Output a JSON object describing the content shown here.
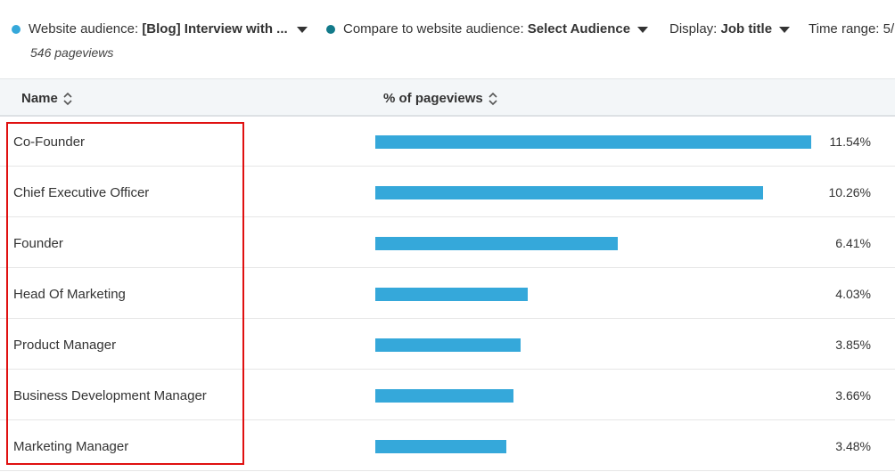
{
  "filters": {
    "audience_label": "Website audience:",
    "audience_value": "[Blog] Interview with ...",
    "audience_color": "#35a8da",
    "compare_label": "Compare to website audience:",
    "compare_value": "Select Audience",
    "compare_color": "#127a8a",
    "display_label": "Display:",
    "display_value": "Job title",
    "time_label": "Time range:",
    "time_value": "5/",
    "pageviews": "546 pageviews"
  },
  "table": {
    "columns": [
      "Name",
      "% of pageviews"
    ],
    "rows": [
      {
        "name": "Co-Founder",
        "percent": "11.54%",
        "value": 11.54
      },
      {
        "name": "Chief Executive Officer",
        "percent": "10.26%",
        "value": 10.26
      },
      {
        "name": "Founder",
        "percent": "6.41%",
        "value": 6.41
      },
      {
        "name": "Head Of Marketing",
        "percent": "4.03%",
        "value": 4.03
      },
      {
        "name": "Product Manager",
        "percent": "3.85%",
        "value": 3.85
      },
      {
        "name": "Business Development Manager",
        "percent": "3.66%",
        "value": 3.66
      },
      {
        "name": "Marketing Manager",
        "percent": "3.48%",
        "value": 3.48
      }
    ]
  },
  "colors": {
    "bar": "#35a8da",
    "highlight": "#e01010"
  }
}
